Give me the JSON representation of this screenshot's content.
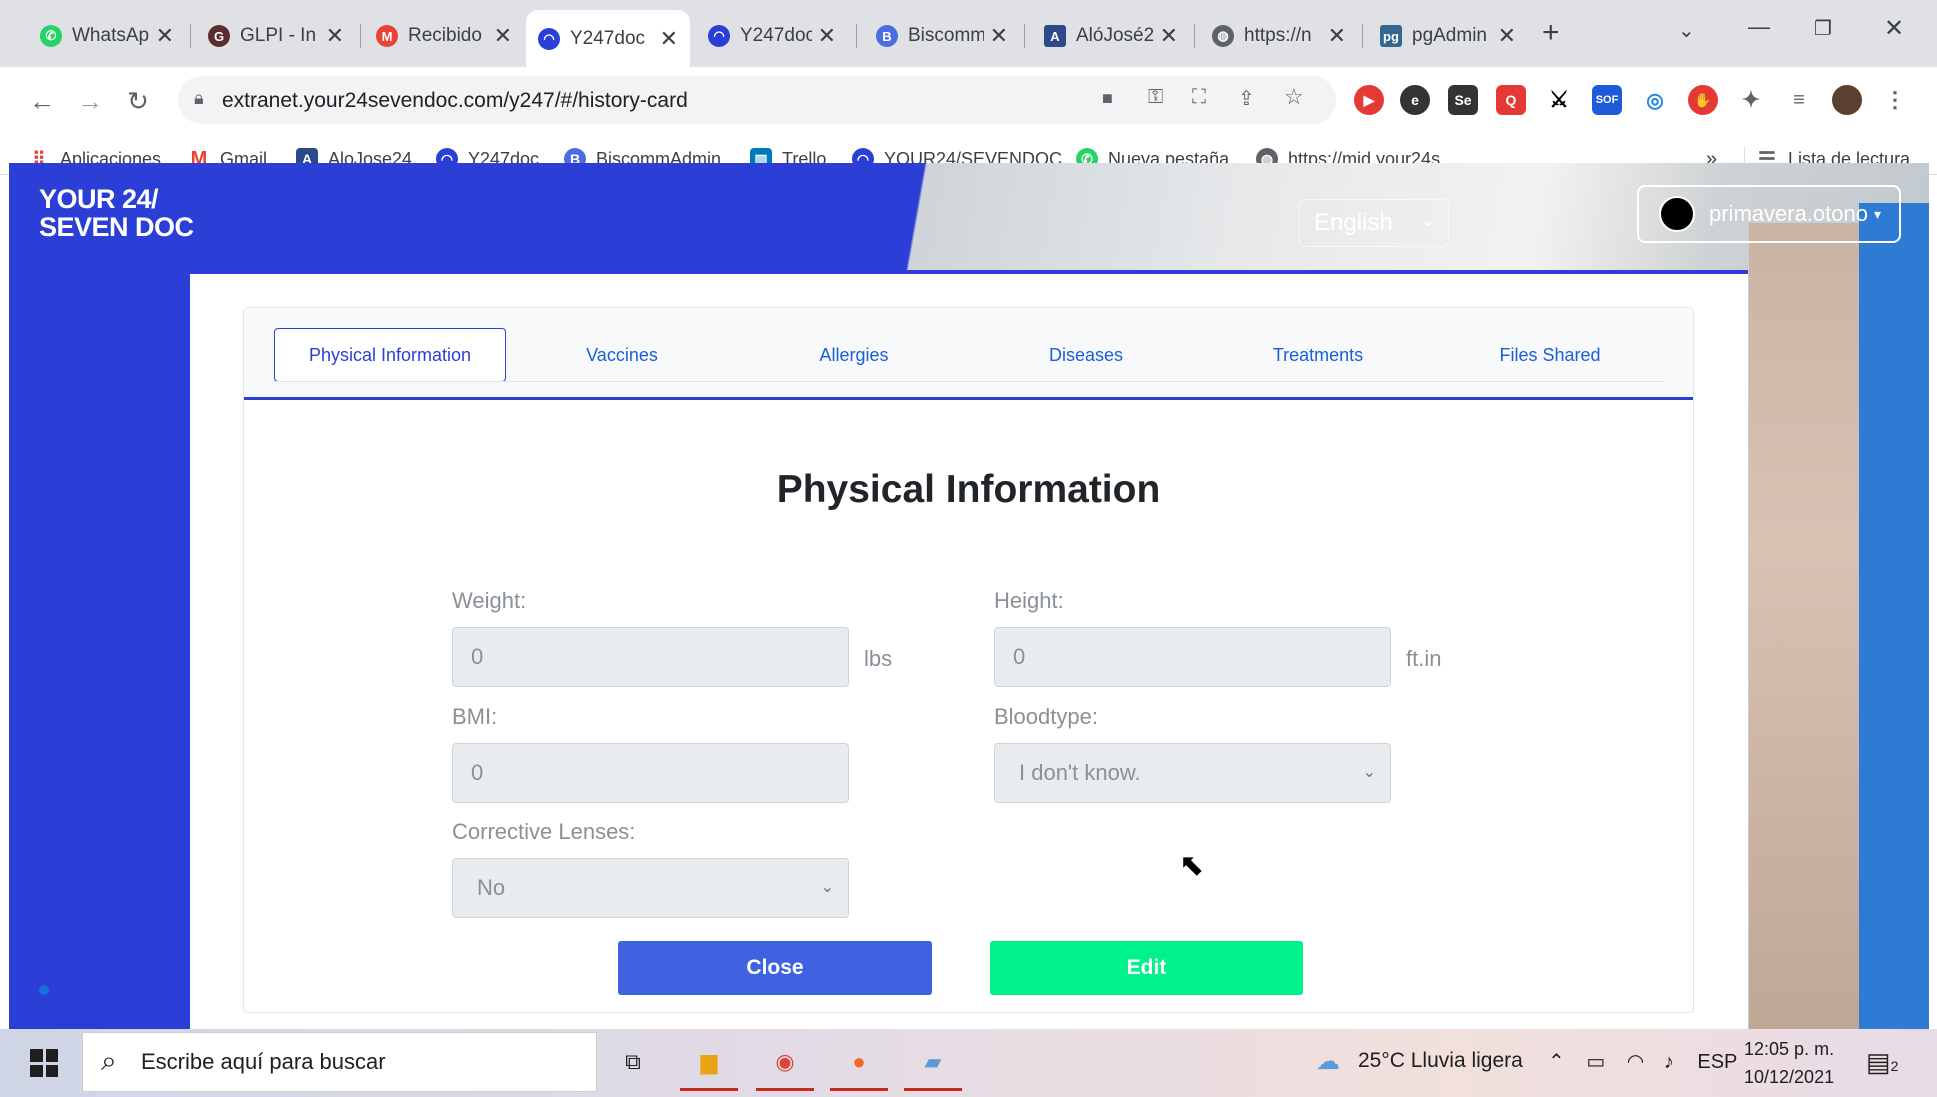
{
  "browser": {
    "tabs": [
      {
        "title": "WhatsAp",
        "favicon_color": "#25d366",
        "active": false
      },
      {
        "title": "GLPI - In",
        "favicon_color": "#5b2d2d",
        "active": false
      },
      {
        "title": "Recibido",
        "favicon_color": "#ea4335",
        "active": false
      },
      {
        "title": "Y247doc",
        "favicon_color": "#2b3fd6",
        "active": true
      },
      {
        "title": "Y247doc",
        "favicon_color": "#2b3fd6",
        "active": false
      },
      {
        "title": "Biscomm",
        "favicon_color": "#4a6ee0",
        "active": false
      },
      {
        "title": "AlóJosé2",
        "favicon_color": "#2c4a8a",
        "active": false
      },
      {
        "title": "https://n",
        "favicon_color": "#5f6368",
        "active": false
      },
      {
        "title": "pgAdmin",
        "favicon_color": "#336791",
        "active": false
      }
    ],
    "new_tab_label": "+",
    "url": "extranet.your24sevendoc.com/y247/#/history-card",
    "bookmarks": [
      {
        "label": "Aplicaciones",
        "color": "#ea4335"
      },
      {
        "label": "Gmail",
        "color": "#ea4335"
      },
      {
        "label": "AloJose24",
        "color": "#2c4a8a"
      },
      {
        "label": "Y247doc",
        "color": "#2b3fd6"
      },
      {
        "label": "BiscommAdmin",
        "color": "#4a6ee0"
      },
      {
        "label": "Trello",
        "color": "#0079bf"
      },
      {
        "label": "YOUR24/SEVENDOC",
        "color": "#2b3fd6"
      },
      {
        "label": "Nueva pestaña",
        "color": "#25d366"
      },
      {
        "label": "https://mid.your24s...",
        "color": "#5f6368"
      }
    ],
    "overflow_label": "»",
    "reading_list_label": "Lista de lectura"
  },
  "header": {
    "logo_line1": "YOUR 24/",
    "logo_line2": "SEVEN DOC",
    "language": "English",
    "username": "primavera.otono"
  },
  "tabs": [
    {
      "label": "Physical Information",
      "active": true
    },
    {
      "label": "Vaccines",
      "active": false
    },
    {
      "label": "Allergies",
      "active": false
    },
    {
      "label": "Diseases",
      "active": false
    },
    {
      "label": "Treatments",
      "active": false
    },
    {
      "label": "Files Shared",
      "active": false
    }
  ],
  "form": {
    "title": "Physical Information",
    "weight": {
      "label": "Weight:",
      "value": "0",
      "unit": "lbs"
    },
    "height": {
      "label": "Height:",
      "value": "0",
      "unit": "ft.in"
    },
    "bmi": {
      "label": "BMI:",
      "value": "0"
    },
    "bloodtype": {
      "label": "Bloodtype:",
      "value": "I don't know."
    },
    "corrective_lenses": {
      "label": "Corrective Lenses:",
      "value": "No"
    },
    "close_label": "Close",
    "edit_label": "Edit"
  },
  "taskbar": {
    "search_placeholder": "Escribe aquí para buscar",
    "weather": "25°C  Lluvia ligera",
    "language": "ESP",
    "time": "12:05 p. m.",
    "date": "10/12/2021",
    "notification_count": "2"
  },
  "colors": {
    "brand_blue": "#2b3fd6",
    "close_button": "#3f63e0",
    "edit_button": "#00f28d",
    "tab_link": "#1a5fd6"
  }
}
